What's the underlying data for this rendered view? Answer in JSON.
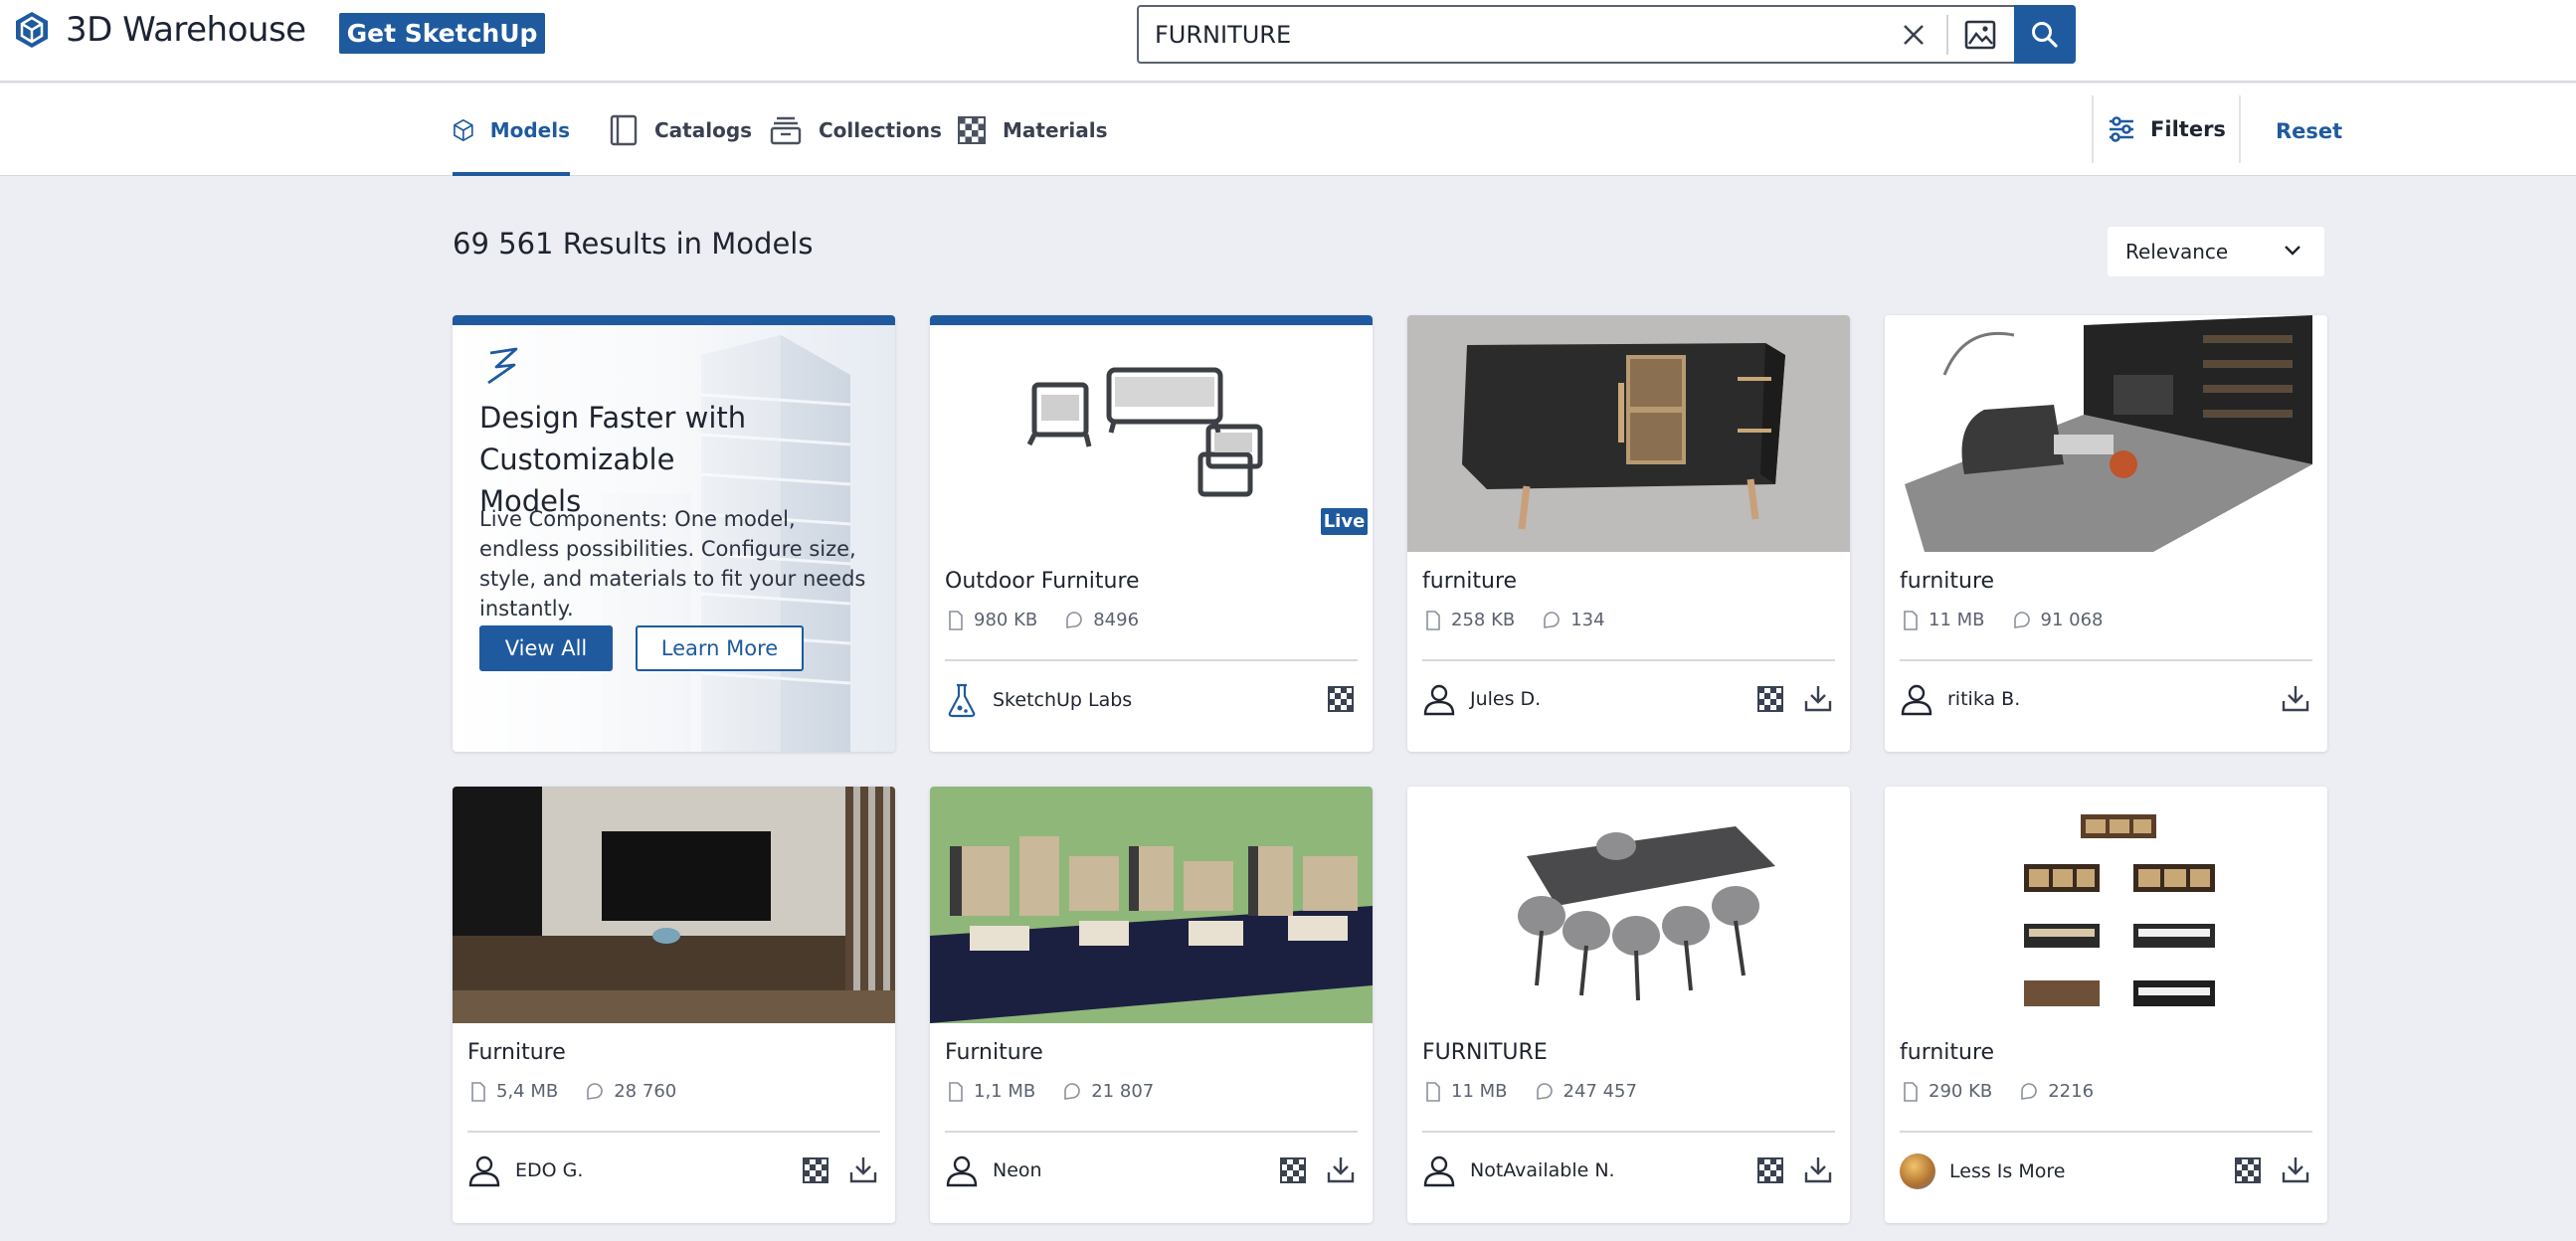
{
  "header": {
    "logo_text": "3D Warehouse",
    "get_sketchup": "Get SketchUp",
    "search_value": "FURNITURE"
  },
  "tabs": [
    {
      "label": "Models",
      "icon": "cube-icon",
      "active": true
    },
    {
      "label": "Catalogs",
      "icon": "catalog-icon",
      "active": false
    },
    {
      "label": "Collections",
      "icon": "collection-icon",
      "active": false
    },
    {
      "label": "Materials",
      "icon": "checker-icon",
      "active": false
    }
  ],
  "toolbar": {
    "filters": "Filters",
    "reset": "Reset"
  },
  "results": {
    "title": "69 561 Results in Models",
    "sort": "Relevance"
  },
  "promo": {
    "title": "Design Faster with Customizable Models",
    "text": "Live Components: One model, endless possibilities. Configure size, style, and materials to fit your needs instantly.",
    "view_all": "View All",
    "learn_more": "Learn More"
  },
  "cards": [
    {
      "title": "Outdoor Furniture",
      "size": "980 KB",
      "views": "8496",
      "author": "SketchUp Labs",
      "badge": "Live"
    },
    {
      "title": "furniture",
      "size": "258 KB",
      "views": "134",
      "author": "Jules D."
    },
    {
      "title": "furniture",
      "size": "11 MB",
      "views": "91 068",
      "author": "ritika B."
    },
    {
      "title": "Furniture",
      "size": "5,4 MB",
      "views": "28 760",
      "author": "EDO G."
    },
    {
      "title": "Furniture",
      "size": "1,1 MB",
      "views": "21 807",
      "author": "Neon"
    },
    {
      "title": "FURNITURE",
      "size": "11 MB",
      "views": "247 457",
      "author": "NotAvailable N."
    },
    {
      "title": "furniture",
      "size": "290 KB",
      "views": "2216",
      "author": "Less Is More"
    }
  ],
  "colors": {
    "brand": "#1f5a9e",
    "background": "#eceef3"
  }
}
